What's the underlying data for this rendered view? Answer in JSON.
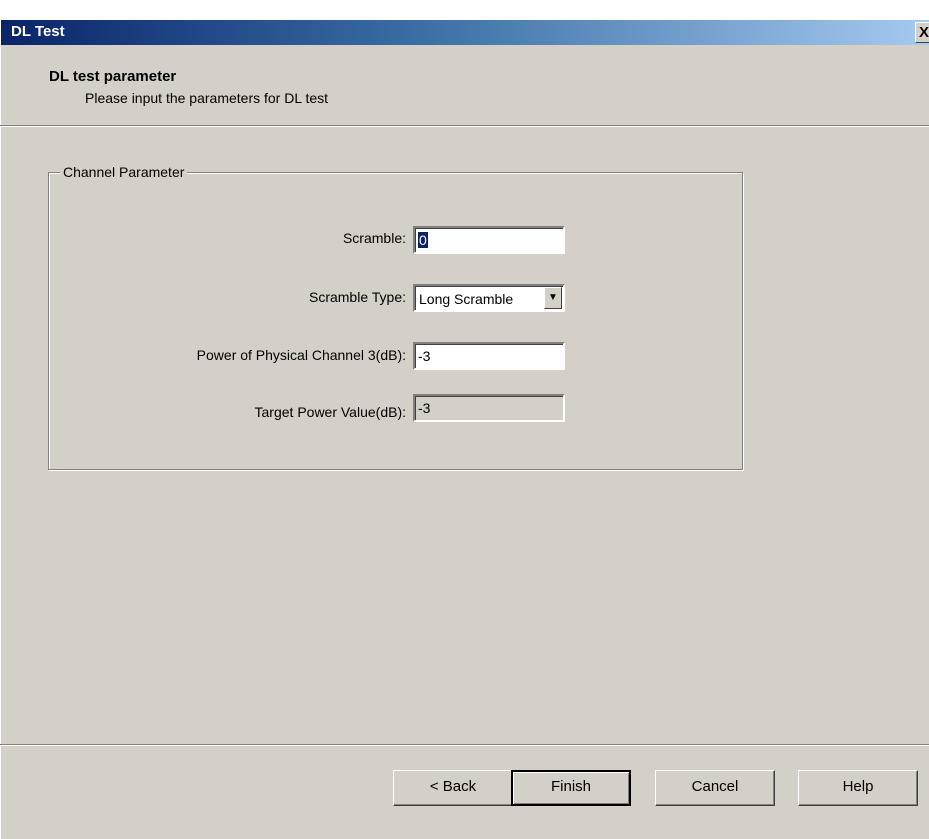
{
  "window": {
    "title": "DL Test",
    "close_symbol": "X"
  },
  "header": {
    "title": "DL test parameter",
    "subtitle": "Please input the parameters for DL test"
  },
  "group": {
    "legend": "Channel Parameter",
    "fields": {
      "scramble": {
        "label": "Scramble:",
        "value": "0"
      },
      "scramble_type": {
        "label": "Scramble Type:",
        "value": "Long Scramble"
      },
      "power_channel3": {
        "label": "Power of Physical Channel 3(dB):",
        "value": "-3"
      },
      "target_power": {
        "label": "Target Power Value(dB):",
        "value": "-3"
      }
    }
  },
  "buttons": {
    "back": "< Back",
    "finish": "Finish",
    "cancel": "Cancel",
    "help": "Help"
  },
  "icons": {
    "dropdown": "chevron-down-icon",
    "close": "close-icon"
  },
  "colors": {
    "title_start": "#0a246a",
    "title_end": "#a6caf0",
    "face": "#d4d0c8"
  }
}
